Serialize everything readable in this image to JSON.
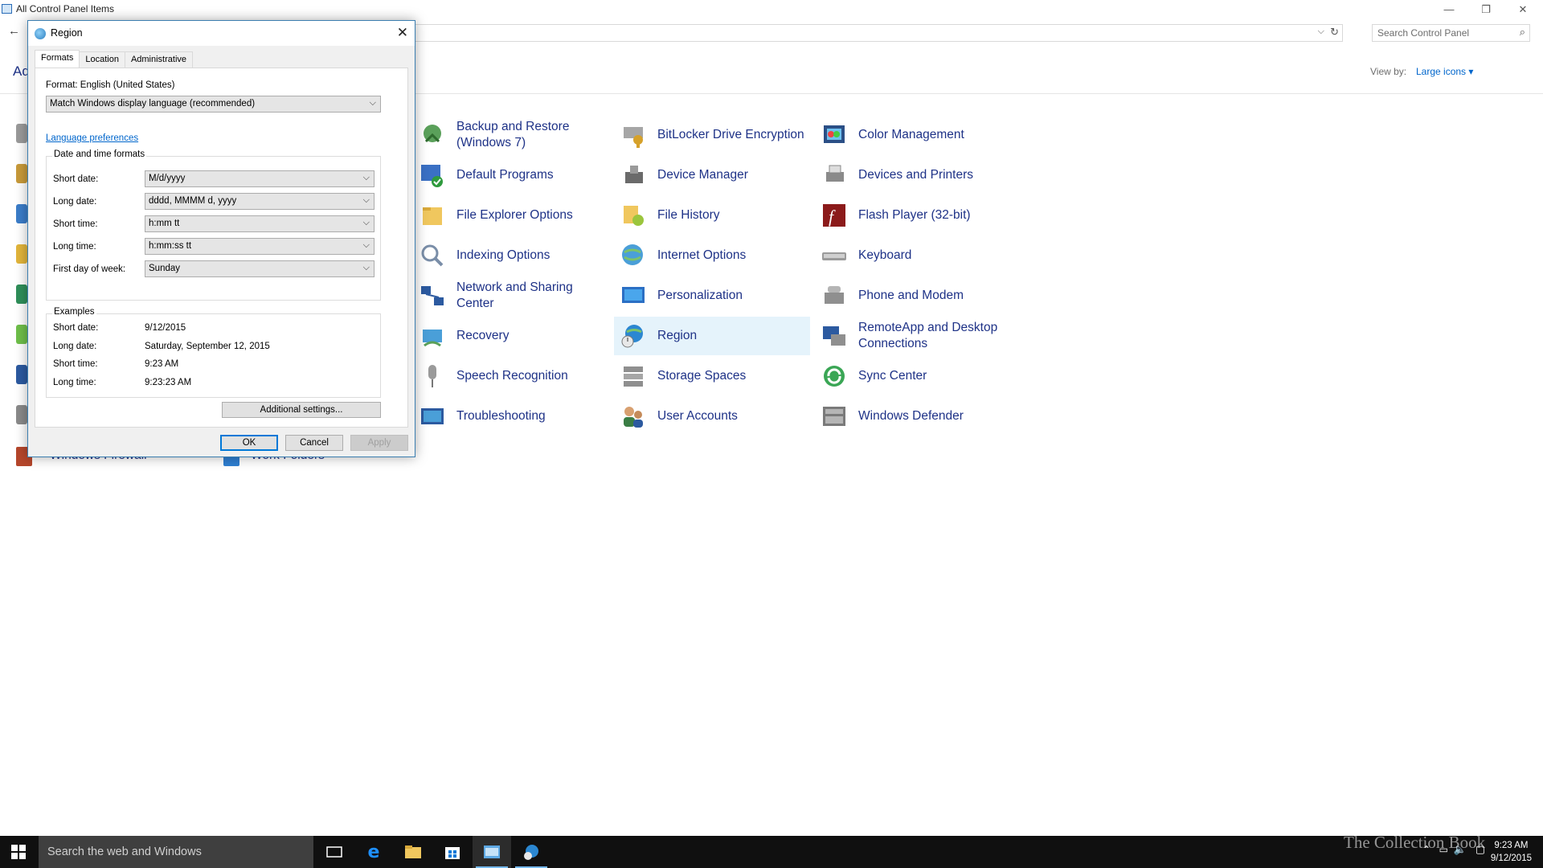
{
  "window": {
    "title": "All Control Panel Items",
    "search_placeholder": "Search Control Panel",
    "heading": "Ad",
    "view_by_label": "View by:",
    "view_by_value": "Large icons ▾"
  },
  "items": [
    {
      "label": "Backup and Restore (Windows 7)",
      "icon": "backup-icon"
    },
    {
      "label": "BitLocker Drive Encryption",
      "icon": "bitlocker-icon"
    },
    {
      "label": "Color Management",
      "icon": "color-management-icon"
    },
    {
      "label": "Default Programs",
      "icon": "default-programs-icon"
    },
    {
      "label": "Device Manager",
      "icon": "device-manager-icon"
    },
    {
      "label": "Devices and Printers",
      "icon": "printer-icon"
    },
    {
      "label": "File Explorer Options",
      "icon": "folder-options-icon"
    },
    {
      "label": "File History",
      "icon": "file-history-icon"
    },
    {
      "label": "Flash Player (32-bit)",
      "icon": "flash-icon"
    },
    {
      "label": "Indexing Options",
      "icon": "indexing-icon"
    },
    {
      "label": "Internet Options",
      "icon": "internet-options-icon"
    },
    {
      "label": "Keyboard",
      "icon": "keyboard-icon"
    },
    {
      "label": "Network and Sharing Center",
      "icon": "network-icon"
    },
    {
      "label": "Personalization",
      "icon": "personalization-icon"
    },
    {
      "label": "Phone and Modem",
      "icon": "phone-icon"
    },
    {
      "label": "Recovery",
      "icon": "recovery-icon"
    },
    {
      "label": "Region",
      "icon": "region-icon"
    },
    {
      "label": "RemoteApp and Desktop Connections",
      "icon": "remoteapp-icon"
    },
    {
      "label": "Speech Recognition",
      "icon": "microphone-icon"
    },
    {
      "label": "Storage Spaces",
      "icon": "storage-icon"
    },
    {
      "label": "Sync Center",
      "icon": "sync-icon"
    },
    {
      "label": "Troubleshooting",
      "icon": "troubleshooting-icon"
    },
    {
      "label": "User Accounts",
      "icon": "user-accounts-icon"
    },
    {
      "label": "Windows Defender",
      "icon": "defender-icon"
    }
  ],
  "hidden_items": {
    "firewall": "Windows Firewall",
    "work_folders": "Work Folders"
  },
  "dialog": {
    "title": "Region",
    "tabs": [
      "Formats",
      "Location",
      "Administrative"
    ],
    "format_label": "Format: English (United States)",
    "format_value": "Match Windows display language (recommended)",
    "language_link": "Language preferences",
    "dt_group_title": "Date and time formats",
    "short_date_label": "Short date:",
    "short_date_value": "M/d/yyyy",
    "long_date_label": "Long date:",
    "long_date_value": "dddd, MMMM d, yyyy",
    "short_time_label": "Short time:",
    "short_time_value": "h:mm tt",
    "long_time_label": "Long time:",
    "long_time_value": "h:mm:ss tt",
    "first_day_label": "First day of week:",
    "first_day_value": "Sunday",
    "examples_title": "Examples",
    "ex_short_date_label": "Short date:",
    "ex_short_date": "9/12/2015",
    "ex_long_date_label": "Long date:",
    "ex_long_date": "Saturday, September 12, 2015",
    "ex_short_time_label": "Short time:",
    "ex_short_time": "9:23 AM",
    "ex_long_time_label": "Long time:",
    "ex_long_time": "9:23:23 AM",
    "additional_button": "Additional settings...",
    "ok_button": "OK",
    "cancel_button": "Cancel",
    "apply_button": "Apply"
  },
  "taskbar": {
    "search_text": "Search the web and Windows",
    "time": "9:23 AM",
    "date": "9/12/2015",
    "watermark": "The Collection Book"
  },
  "colors": {
    "link": "#1e3287",
    "accent": "#0078d7",
    "selected_bg": "#e5f3fb",
    "taskbar": "#101010"
  }
}
